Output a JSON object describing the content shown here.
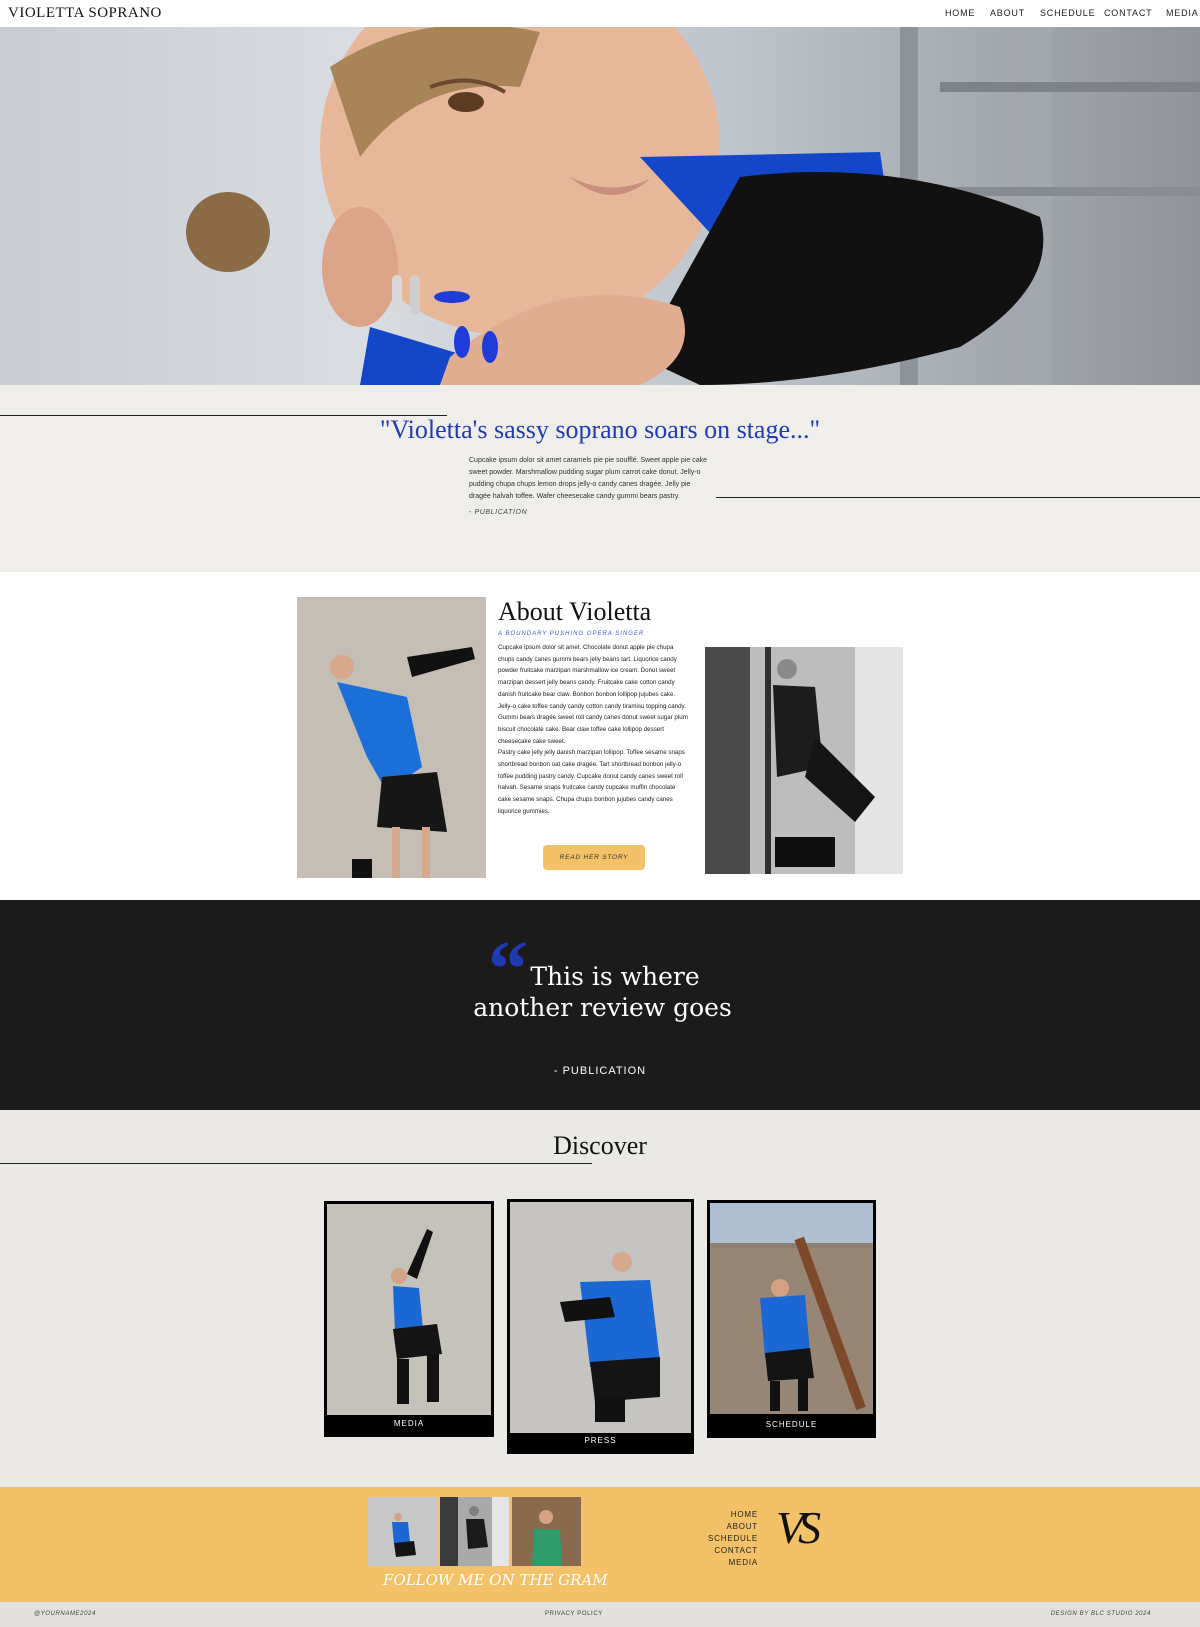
{
  "header": {
    "logo": "VIOLETTA SOPRANO",
    "nav": [
      "HOME",
      "ABOUT",
      "SCHEDULE",
      "CONTACT",
      "MEDIA"
    ]
  },
  "review1": {
    "quote": "\"Violetta's sassy soprano soars on stage...\"",
    "body": "Cupcake ipsum dolor sit amet caramels pie pie soufflé. Sweet apple pie cake sweet powder. Marshmallow pudding sugar plum carrot cake donut. Jelly-o pudding chupa chups lemon drops jelly-o candy canes dragée. Jelly pie dragée halvah toffee. Wafer cheesecake candy gummi bears pastry.",
    "publication": "- PUBLICATION"
  },
  "about": {
    "title": "About Violetta",
    "subtitle": "A BOUNDARY PUSHING OPERA SINGER",
    "paragraph1": "Cupcake ipsum dolor sit amet. Chocolate donut apple pie chupa chups candy canes gummi bears jelly beans tart. Liquorice candy powder fruitcake marzipan marshmallow ice cream. Donut sweet marzipan dessert jelly beans candy. Fruitcake cake cotton candy danish fruitcake bear claw. Bonbon bonbon lollipop jujubes cake. Jelly-o cake toffee candy candy cotton candy tiramisu topping candy. Gummi bears dragée sweet roll candy canes donut sweet sugar plum biscuit chocolate cake. Bear claw toffee cake lollipop dessert cheesecake cake sweet.",
    "paragraph2": "Pastry cake jelly jelly danish marzipan lollipop. Toffee sesame snaps shortbread bonbon oat cake dragée. Tart shortbread bonbon jelly-o toffee pudding pastry candy. Cupcake donut candy canes sweet roll halvah. Sesame snaps fruitcake candy cupcake muffin chocolate cake sesame snaps. Chupa chups bonbon jujubes candy canes liquorice gummies.",
    "button": "READ HER STORY"
  },
  "review2": {
    "line1": "This is where",
    "line2": "another review goes",
    "publication": "- PUBLICATION"
  },
  "discover": {
    "title": "Discover",
    "cards": [
      "MEDIA",
      "PRESS",
      "SCHEDULE"
    ]
  },
  "footer": {
    "instagram": "FOLLOW ME ON THE GRAM",
    "nav": [
      "HOME",
      "ABOUT",
      "SCHEDULE",
      "CONTACT",
      "MEDIA"
    ],
    "monogram": "VS",
    "handle": "@YOURNAME2024",
    "privacy": "PRIVACY POLICY",
    "credit": "DESIGN BY BLC STUDIO 2024"
  },
  "colors": {
    "accent_blue": "#1f3bb3",
    "gold": "#f2c168",
    "dark": "#1b1b1b",
    "cream": "#efeeeb"
  }
}
